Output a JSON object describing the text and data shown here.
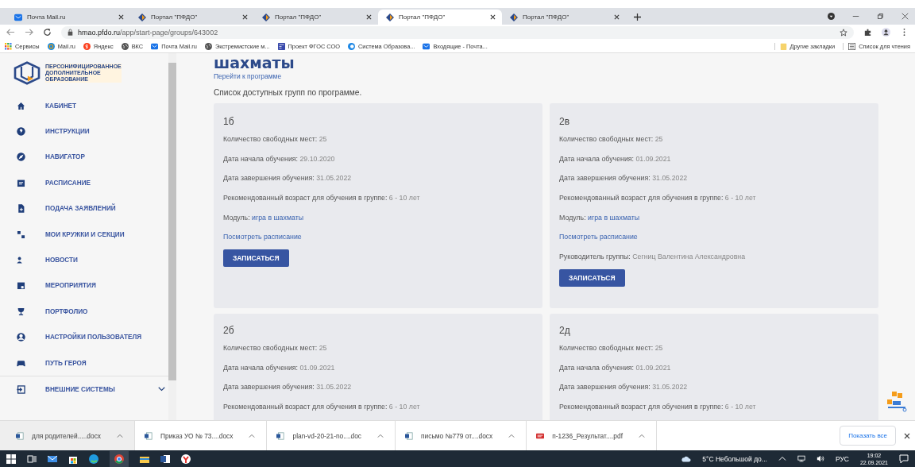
{
  "browser": {
    "tabs": [
      {
        "title": "Почта Mail.ru",
        "kind": "mail",
        "selected": false
      },
      {
        "title": "Портал \"ПФДО\"",
        "kind": "pfdo",
        "selected": false
      },
      {
        "title": "Портал \"ПФДО\"",
        "kind": "pfdo",
        "selected": false
      },
      {
        "title": "Портал \"ПФДО\"",
        "kind": "pfdo",
        "selected": true
      },
      {
        "title": "Портал \"ПФДО\"",
        "kind": "pfdo",
        "selected": false
      }
    ],
    "address": {
      "host": "hmao.pfdo.ru",
      "path": "/app/start-page/groups/643002"
    },
    "bookmarks": [
      {
        "label": "Сервисы",
        "kind": "apps"
      },
      {
        "label": "Mail.ru",
        "kind": "mailru"
      },
      {
        "label": "Яндекс",
        "kind": "yandex"
      },
      {
        "label": "ВКС",
        "kind": "globe"
      },
      {
        "label": "Почта Mail.ru",
        "kind": "mail"
      },
      {
        "label": "Экстремистские м...",
        "kind": "globe"
      },
      {
        "label": "Проект ФГОС СОО",
        "kind": "form"
      },
      {
        "label": "Система Образова...",
        "kind": "edu"
      },
      {
        "label": "Входящие - Почта...",
        "kind": "mail"
      }
    ],
    "bookmarks_right": [
      {
        "label": "Другие закладки",
        "kind": "folder"
      },
      {
        "label": "Список для чтения",
        "kind": "list"
      }
    ]
  },
  "sidebar": {
    "logo_lines": [
      "ПЕРСОНИФИЦИРОВАННОЕ",
      "ДОПОЛНИТЕЛЬНОЕ",
      "ОБРАЗОВАНИЕ"
    ],
    "items": [
      "КАБИНЕТ",
      "ИНСТРУКЦИИ",
      "НАВИГАТОР",
      "РАСПИСАНИЕ",
      "ПОДАЧА ЗАЯВЛЕНИЙ",
      "МОИ КРУЖКИ И СЕКЦИИ",
      "НОВОСТИ",
      "МЕРОПРИЯТИЯ",
      "ПОРТФОЛИО",
      "НАСТРОЙКИ ПОЛЬЗОВАТЕЛЯ",
      "ПУТЬ ГЕРОЯ"
    ],
    "footer_item": {
      "label": "ВНЕШНИЕ СИСТЕМЫ",
      "expanded": false
    }
  },
  "main": {
    "title": "шахматы",
    "program_link": "Перейти к программе",
    "subtitle": "Список доступных групп по программе.",
    "groups": [
      {
        "name": "1б",
        "lines": [
          {
            "kind": "field",
            "label": "Количество свободных мест:",
            "value": "25"
          },
          {
            "kind": "field",
            "label": "Дата начала обучения:",
            "value": "29.10.2020"
          },
          {
            "kind": "field",
            "label": "Дата завершения обучения:",
            "value": "31.05.2022"
          },
          {
            "kind": "field",
            "label": "Рекомендованный возраст для обучения в группе:",
            "value": "6 - 10 лет"
          },
          {
            "kind": "link_field",
            "label": "Модуль:",
            "value": "игра в шахматы"
          },
          {
            "kind": "link",
            "value": "Посмотреть расписание"
          },
          {
            "kind": "button",
            "value": "ЗАПИСАТЬСЯ"
          }
        ]
      },
      {
        "name": "2в",
        "lines": [
          {
            "kind": "field",
            "label": "Количество свободных мест:",
            "value": "25"
          },
          {
            "kind": "field",
            "label": "Дата начала обучения:",
            "value": "01.09.2021"
          },
          {
            "kind": "field",
            "label": "Дата завершения обучения:",
            "value": "31.05.2022"
          },
          {
            "kind": "field",
            "label": "Рекомендованный возраст для обучения в группе:",
            "value": "6 - 10 лет"
          },
          {
            "kind": "link_field",
            "label": "Модуль:",
            "value": "игра в шахматы"
          },
          {
            "kind": "link",
            "value": "Посмотреть расписание"
          },
          {
            "kind": "field",
            "label": "Руководитель группы:",
            "value": "Сегниц Валентина Александровна"
          },
          {
            "kind": "button",
            "value": "ЗАПИСАТЬСЯ"
          }
        ]
      },
      {
        "name": "2б",
        "lines": [
          {
            "kind": "field",
            "label": "Количество свободных мест:",
            "value": "25"
          },
          {
            "kind": "field",
            "label": "Дата начала обучения:",
            "value": "01.09.2021"
          },
          {
            "kind": "field",
            "label": "Дата завершения обучения:",
            "value": "31.05.2022"
          },
          {
            "kind": "field",
            "label": "Рекомендованный возраст для обучения в группе:",
            "value": "6 - 10 лет"
          }
        ]
      },
      {
        "name": "2д",
        "lines": [
          {
            "kind": "field",
            "label": "Количество свободных мест:",
            "value": "25"
          },
          {
            "kind": "field",
            "label": "Дата начала обучения:",
            "value": "01.09.2021"
          },
          {
            "kind": "field",
            "label": "Дата завершения обучения:",
            "value": "31.05.2022"
          },
          {
            "kind": "field",
            "label": "Рекомендованный возраст для обучения в группе:",
            "value": "6 - 10 лет"
          }
        ]
      }
    ]
  },
  "downloads": {
    "items": [
      {
        "name": "для родителей.....docx",
        "kind": "word"
      },
      {
        "name": "Приказ УО № 73....docx",
        "kind": "word"
      },
      {
        "name": "plan-vd-20-21-no....doc",
        "kind": "word"
      },
      {
        "name": "письмо №779 от....docx",
        "kind": "word"
      },
      {
        "name": "п-1236_Результат....pdf",
        "kind": "pdf"
      }
    ],
    "show_all": "Показать все"
  },
  "taskbar": {
    "weather": "5°C  Небольшой до...",
    "language": "РУС",
    "time": "19:02",
    "date": "22.09.2021"
  }
}
